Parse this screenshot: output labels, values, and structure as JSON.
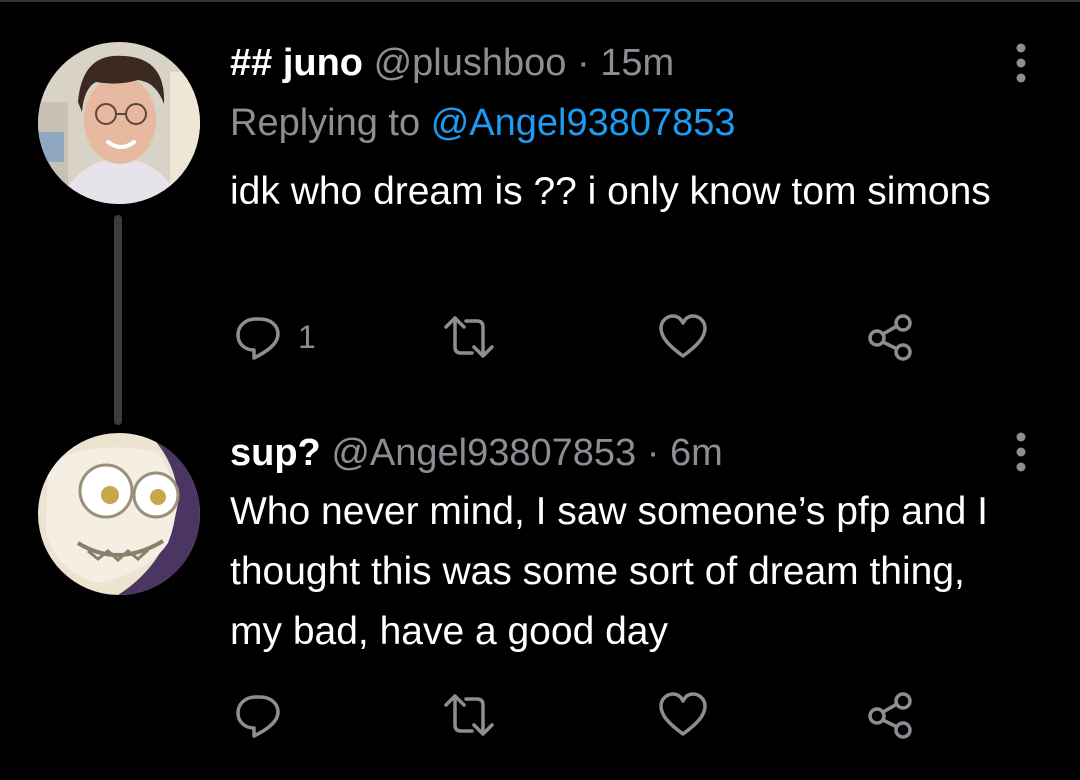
{
  "tweets": [
    {
      "display_name": "## juno",
      "handle": "@plushboo",
      "separator": "·",
      "time": "15m",
      "replying_label": "Replying to",
      "replying_handle": "@Angel93807853",
      "text": "idk who dream is ?? i only know tom simons",
      "reply_count": "1",
      "avatar": "selfie-avatar"
    },
    {
      "display_name": "sup?",
      "handle": "@Angel93807853",
      "separator": "·",
      "time": "6m",
      "text": "Who never mind, I saw someone’s pfp and I thought this was some sort of dream thing, my bad, have a good day",
      "avatar": "cartoon-avatar"
    }
  ],
  "icons": {
    "more": "more-vertical-icon",
    "reply": "reply-icon",
    "retweet": "retweet-icon",
    "like": "heart-icon",
    "share": "share-icon"
  },
  "colors": {
    "background": "#000000",
    "primary_text": "#ffffff",
    "secondary_text": "#8b8f93",
    "link": "#1d9bf0",
    "thread_line": "#3a3d40"
  }
}
